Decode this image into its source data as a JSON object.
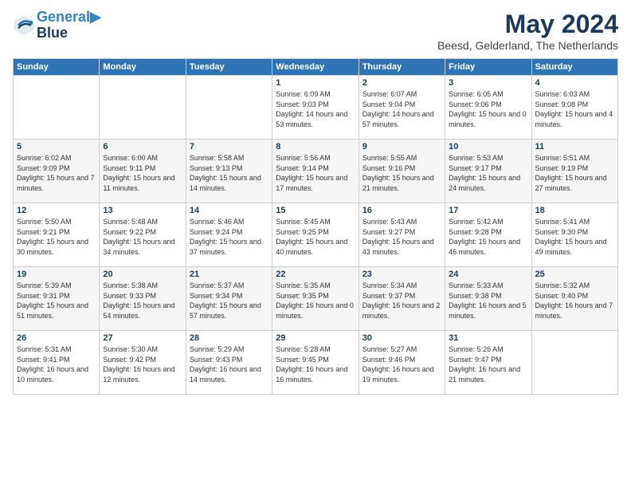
{
  "header": {
    "logo_line1": "General",
    "logo_line2": "Blue",
    "month_title": "May 2024",
    "subtitle": "Beesd, Gelderland, The Netherlands"
  },
  "weekdays": [
    "Sunday",
    "Monday",
    "Tuesday",
    "Wednesday",
    "Thursday",
    "Friday",
    "Saturday"
  ],
  "weeks": [
    [
      {
        "day": "",
        "info": ""
      },
      {
        "day": "",
        "info": ""
      },
      {
        "day": "",
        "info": ""
      },
      {
        "day": "1",
        "info": "Sunrise: 6:09 AM\nSunset: 9:03 PM\nDaylight: 14 hours and 53 minutes."
      },
      {
        "day": "2",
        "info": "Sunrise: 6:07 AM\nSunset: 9:04 PM\nDaylight: 14 hours and 57 minutes."
      },
      {
        "day": "3",
        "info": "Sunrise: 6:05 AM\nSunset: 9:06 PM\nDaylight: 15 hours and 0 minutes."
      },
      {
        "day": "4",
        "info": "Sunrise: 6:03 AM\nSunset: 9:08 PM\nDaylight: 15 hours and 4 minutes."
      }
    ],
    [
      {
        "day": "5",
        "info": "Sunrise: 6:02 AM\nSunset: 9:09 PM\nDaylight: 15 hours and 7 minutes."
      },
      {
        "day": "6",
        "info": "Sunrise: 6:00 AM\nSunset: 9:11 PM\nDaylight: 15 hours and 11 minutes."
      },
      {
        "day": "7",
        "info": "Sunrise: 5:58 AM\nSunset: 9:13 PM\nDaylight: 15 hours and 14 minutes."
      },
      {
        "day": "8",
        "info": "Sunrise: 5:56 AM\nSunset: 9:14 PM\nDaylight: 15 hours and 17 minutes."
      },
      {
        "day": "9",
        "info": "Sunrise: 5:55 AM\nSunset: 9:16 PM\nDaylight: 15 hours and 21 minutes."
      },
      {
        "day": "10",
        "info": "Sunrise: 5:53 AM\nSunset: 9:17 PM\nDaylight: 15 hours and 24 minutes."
      },
      {
        "day": "11",
        "info": "Sunrise: 5:51 AM\nSunset: 9:19 PM\nDaylight: 15 hours and 27 minutes."
      }
    ],
    [
      {
        "day": "12",
        "info": "Sunrise: 5:50 AM\nSunset: 9:21 PM\nDaylight: 15 hours and 30 minutes."
      },
      {
        "day": "13",
        "info": "Sunrise: 5:48 AM\nSunset: 9:22 PM\nDaylight: 15 hours and 34 minutes."
      },
      {
        "day": "14",
        "info": "Sunrise: 5:46 AM\nSunset: 9:24 PM\nDaylight: 15 hours and 37 minutes."
      },
      {
        "day": "15",
        "info": "Sunrise: 5:45 AM\nSunset: 9:25 PM\nDaylight: 15 hours and 40 minutes."
      },
      {
        "day": "16",
        "info": "Sunrise: 5:43 AM\nSunset: 9:27 PM\nDaylight: 15 hours and 43 minutes."
      },
      {
        "day": "17",
        "info": "Sunrise: 5:42 AM\nSunset: 9:28 PM\nDaylight: 15 hours and 46 minutes."
      },
      {
        "day": "18",
        "info": "Sunrise: 5:41 AM\nSunset: 9:30 PM\nDaylight: 15 hours and 49 minutes."
      }
    ],
    [
      {
        "day": "19",
        "info": "Sunrise: 5:39 AM\nSunset: 9:31 PM\nDaylight: 15 hours and 51 minutes."
      },
      {
        "day": "20",
        "info": "Sunrise: 5:38 AM\nSunset: 9:33 PM\nDaylight: 15 hours and 54 minutes."
      },
      {
        "day": "21",
        "info": "Sunrise: 5:37 AM\nSunset: 9:34 PM\nDaylight: 15 hours and 57 minutes."
      },
      {
        "day": "22",
        "info": "Sunrise: 5:35 AM\nSunset: 9:35 PM\nDaylight: 16 hours and 0 minutes."
      },
      {
        "day": "23",
        "info": "Sunrise: 5:34 AM\nSunset: 9:37 PM\nDaylight: 16 hours and 2 minutes."
      },
      {
        "day": "24",
        "info": "Sunrise: 5:33 AM\nSunset: 9:38 PM\nDaylight: 16 hours and 5 minutes."
      },
      {
        "day": "25",
        "info": "Sunrise: 5:32 AM\nSunset: 9:40 PM\nDaylight: 16 hours and 7 minutes."
      }
    ],
    [
      {
        "day": "26",
        "info": "Sunrise: 5:31 AM\nSunset: 9:41 PM\nDaylight: 16 hours and 10 minutes."
      },
      {
        "day": "27",
        "info": "Sunrise: 5:30 AM\nSunset: 9:42 PM\nDaylight: 16 hours and 12 minutes."
      },
      {
        "day": "28",
        "info": "Sunrise: 5:29 AM\nSunset: 9:43 PM\nDaylight: 16 hours and 14 minutes."
      },
      {
        "day": "29",
        "info": "Sunrise: 5:28 AM\nSunset: 9:45 PM\nDaylight: 16 hours and 16 minutes."
      },
      {
        "day": "30",
        "info": "Sunrise: 5:27 AM\nSunset: 9:46 PM\nDaylight: 16 hours and 19 minutes."
      },
      {
        "day": "31",
        "info": "Sunrise: 5:26 AM\nSunset: 9:47 PM\nDaylight: 16 hours and 21 minutes."
      },
      {
        "day": "",
        "info": ""
      }
    ]
  ]
}
